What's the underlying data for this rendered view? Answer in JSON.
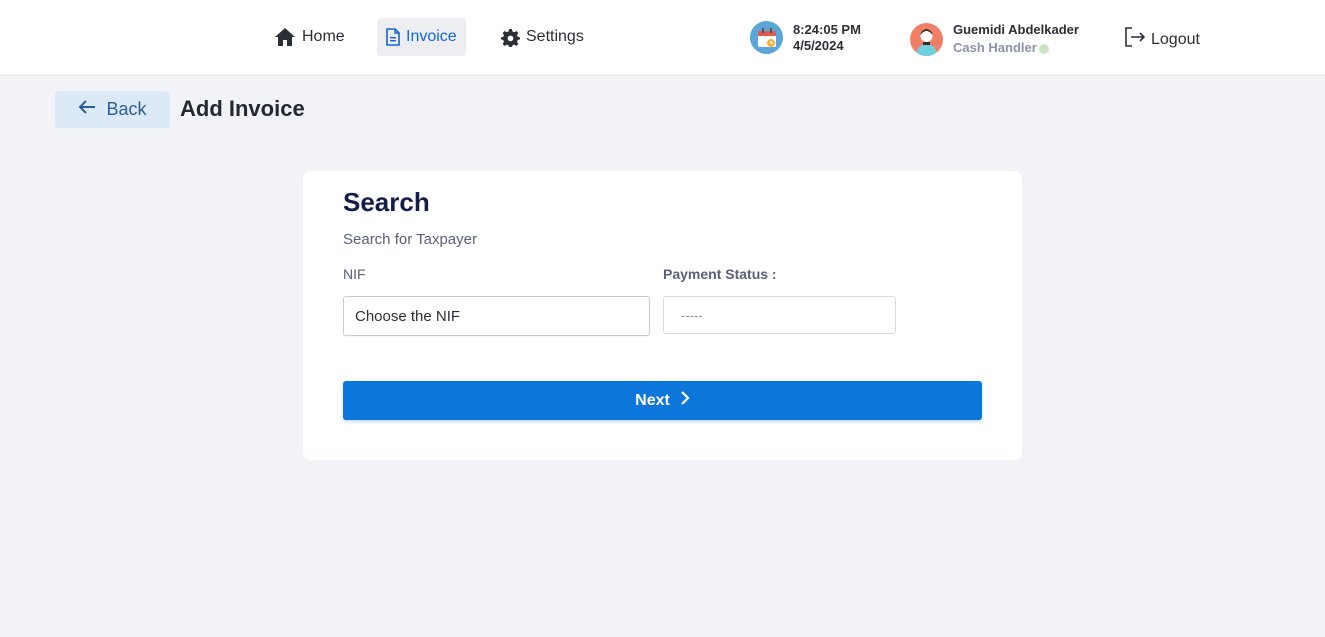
{
  "nav": {
    "items": [
      {
        "label": "Home",
        "icon": "home-icon"
      },
      {
        "label": "Invoice",
        "icon": "document-icon",
        "active": true
      },
      {
        "label": "Settings",
        "icon": "gear-icon"
      }
    ]
  },
  "clock": {
    "time": "8:24:05 PM",
    "date": "4/5/2024",
    "icon": "calendar-icon"
  },
  "user": {
    "name": "Guemidi Abdelkader",
    "role": "Cash Handler",
    "status_color": "#c9e6c3"
  },
  "logout": {
    "label": "Logout",
    "icon": "logout-icon"
  },
  "page": {
    "back_label": "Back",
    "title": "Add Invoice"
  },
  "search": {
    "title": "Search",
    "subtitle": "Search for Taxpayer",
    "nif_label": "NIF",
    "nif_value": "Choose the NIF",
    "payment_label": "Payment Status :",
    "payment_placeholder": "-----",
    "next_label": "Next"
  },
  "colors": {
    "accent": "#0d76db",
    "active_nav": "#1565d8",
    "background": "#f2f3f7"
  }
}
